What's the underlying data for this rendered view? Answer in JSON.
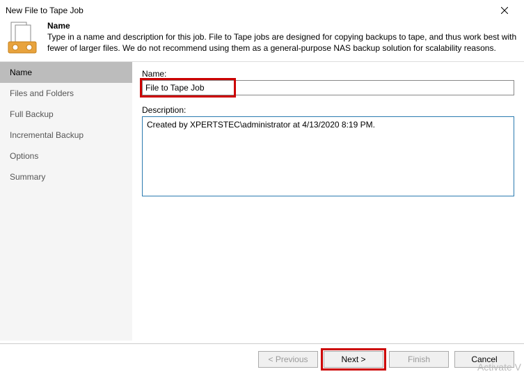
{
  "window": {
    "title": "New File to Tape Job"
  },
  "header": {
    "title": "Name",
    "description": "Type in a name and description for this job. File to Tape jobs are designed for copying backups to tape, and thus work best with fewer of larger files. We do not recommend using them as a general-purpose NAS backup solution for scalability reasons."
  },
  "sidebar": {
    "items": [
      {
        "label": "Name"
      },
      {
        "label": "Files and Folders"
      },
      {
        "label": "Full Backup"
      },
      {
        "label": "Incremental Backup"
      },
      {
        "label": "Options"
      },
      {
        "label": "Summary"
      }
    ],
    "activeIndex": 0
  },
  "form": {
    "nameLabel": "Name:",
    "nameValue": "File to Tape Job",
    "descLabel": "Description:",
    "descValue": "Created by XPERTSTEC\\administrator at 4/13/2020 8:19 PM."
  },
  "buttons": {
    "previous": "< Previous",
    "next": "Next >",
    "finish": "Finish",
    "cancel": "Cancel"
  },
  "watermark": "Activate V"
}
